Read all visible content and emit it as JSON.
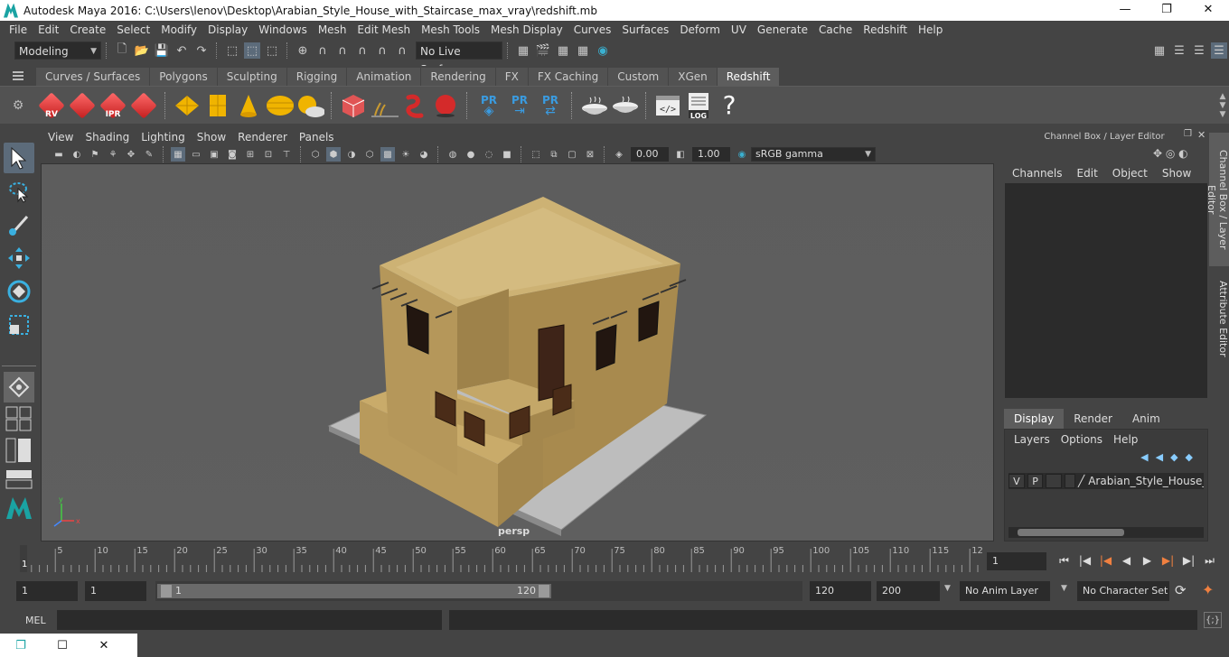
{
  "window": {
    "title": "Autodesk Maya 2016: C:\\Users\\lenov\\Desktop\\Arabian_Style_House_with_Staircase_max_vray\\redshift.mb",
    "minimize": "—",
    "maximize": "❐",
    "close": "✕"
  },
  "menubar": [
    "File",
    "Edit",
    "Create",
    "Select",
    "Modify",
    "Display",
    "Windows",
    "Mesh",
    "Edit Mesh",
    "Mesh Tools",
    "Mesh Display",
    "Curves",
    "Surfaces",
    "Deform",
    "UV",
    "Generate",
    "Cache",
    "Redshift",
    "Help"
  ],
  "statusline": {
    "mode": "Modeling",
    "live_surface": "No Live Surface"
  },
  "shelf_tabs": [
    "Curves / Surfaces",
    "Polygons",
    "Sculpting",
    "Rigging",
    "Animation",
    "Rendering",
    "FX",
    "FX Caching",
    "Custom",
    "XGen",
    "Redshift"
  ],
  "shelf_active": "Redshift",
  "shelf": {
    "rv_label": "RV",
    "ipr_label": "IPR",
    "pr_label": "PR",
    "log_label": "LOG",
    "help_label": "?"
  },
  "panel_menu": [
    "View",
    "Shading",
    "Lighting",
    "Show",
    "Renderer",
    "Panels"
  ],
  "panel_toolbar": {
    "exposure": "0.00",
    "gamma": "1.00",
    "color_space": "sRGB gamma"
  },
  "viewport": {
    "camera": "persp"
  },
  "channel_box": {
    "header": "Channel Box / Layer Editor",
    "menu": [
      "Channels",
      "Edit",
      "Object",
      "Show"
    ]
  },
  "layer_editor": {
    "tabs": [
      "Display",
      "Render",
      "Anim"
    ],
    "active_tab": "Display",
    "menu": [
      "Layers",
      "Options",
      "Help"
    ],
    "layer": {
      "visible": "V",
      "playback": "P",
      "name": "Arabian_Style_House_wi"
    }
  },
  "side_tabs": [
    "Channel Box / Layer Editor",
    "Attribute Editor"
  ],
  "time_slider": {
    "ticks": [
      "5",
      "10",
      "15",
      "20",
      "25",
      "30",
      "35",
      "40",
      "45",
      "50",
      "55",
      "60",
      "65",
      "70",
      "75",
      "80",
      "85",
      "90",
      "95",
      "100",
      "105",
      "110",
      "115",
      "12"
    ],
    "current_label": "1",
    "current_frame": "1"
  },
  "range": {
    "start": "1",
    "playback_start": "1",
    "slider_start": "1",
    "slider_end": "120",
    "playback_end": "120",
    "end": "200",
    "anim_layer": "No Anim Layer",
    "character_set": "No Character Set"
  },
  "command_line": {
    "language": "MEL"
  },
  "colors": {
    "accent": "#5c6b7a",
    "redshift_red": "#d42a2a",
    "pr_blue": "#3a9be0",
    "shelf_yellow": "#f0b400"
  }
}
